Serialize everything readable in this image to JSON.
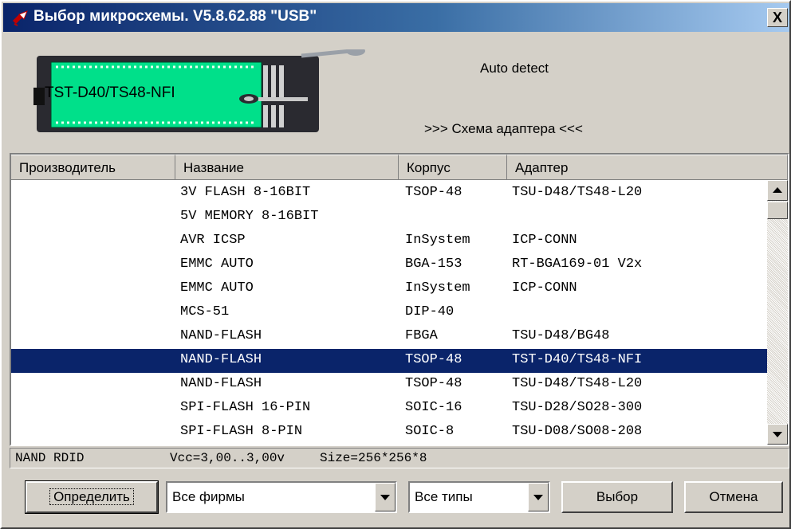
{
  "window": {
    "title": "Выбор микросхемы.  V5.8.62.88 \"USB\"",
    "close_label": "X"
  },
  "header": {
    "adapter_label": "TST-D40/TS48-NFI",
    "auto_detect": "Auto detect",
    "schema_link": ">>> Схема адаптера <<<"
  },
  "columns": {
    "manufacturer": "Производитель",
    "name": "Название",
    "package": "Корпус",
    "adapter": "Адаптер"
  },
  "rows": [
    {
      "manufacturer": "",
      "name": "3V FLASH 8-16BIT",
      "package": "TSOP-48",
      "adapter": "TSU-D48/TS48-L20",
      "selected": false
    },
    {
      "manufacturer": "",
      "name": "5V MEMORY 8-16BIT",
      "package": "",
      "adapter": "",
      "selected": false
    },
    {
      "manufacturer": "",
      "name": "AVR ICSP",
      "package": "InSystem",
      "adapter": "ICP-CONN",
      "selected": false
    },
    {
      "manufacturer": "",
      "name": "EMMC AUTO",
      "package": "BGA-153",
      "adapter": "RT-BGA169-01 V2x",
      "selected": false
    },
    {
      "manufacturer": "",
      "name": "EMMC AUTO",
      "package": "InSystem",
      "adapter": "ICP-CONN",
      "selected": false
    },
    {
      "manufacturer": "",
      "name": "MCS-51",
      "package": "DIP-40",
      "adapter": "",
      "selected": false
    },
    {
      "manufacturer": "",
      "name": "NAND-FLASH",
      "package": "FBGA",
      "adapter": "TSU-D48/BG48",
      "selected": false
    },
    {
      "manufacturer": "",
      "name": "NAND-FLASH",
      "package": "TSOP-48",
      "adapter": "TST-D40/TS48-NFI",
      "selected": true
    },
    {
      "manufacturer": "",
      "name": "NAND-FLASH",
      "package": "TSOP-48",
      "adapter": "TSU-D48/TS48-L20",
      "selected": false
    },
    {
      "manufacturer": "",
      "name": "SPI-FLASH 16-PIN",
      "package": "SOIC-16",
      "adapter": "TSU-D28/SO28-300",
      "selected": false
    },
    {
      "manufacturer": "",
      "name": "SPI-FLASH 8-PIN",
      "package": "SOIC-8",
      "adapter": "TSU-D08/SO08-208",
      "selected": false
    }
  ],
  "status": {
    "mode": "NAND RDID",
    "vcc": "Vcc=3,00..3,00v",
    "size": "Size=256*256*8"
  },
  "buttons": {
    "detect": "Определить",
    "select": "Выбор",
    "cancel": "Отмена"
  },
  "filters": {
    "vendor_selected": "Все фирмы",
    "type_selected": "Все типы"
  },
  "colors": {
    "selection": "#0a246a",
    "board": "#00e08a",
    "face": "#d4d0c8"
  }
}
